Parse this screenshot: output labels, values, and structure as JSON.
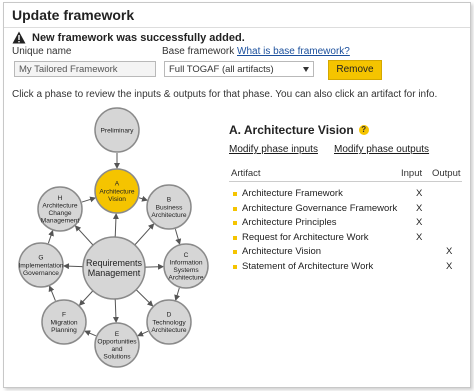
{
  "window": {
    "title": "Update framework"
  },
  "alert": {
    "message": "New framework was successfully added.",
    "icon": "warning-icon"
  },
  "form": {
    "unique_name_label": "Unique name",
    "unique_name_value": "My Tailored Framework",
    "base_label": "Base framework",
    "base_help_link": "What is base framework?",
    "base_value": "Full TOGAF (all artifacts)",
    "remove_label": "Remove"
  },
  "hint": "Click a phase to review the inputs & outputs for that phase. You can also click an artifact for info.",
  "phases": {
    "preliminary": [
      "Preliminary"
    ],
    "a": [
      "A",
      "Architecture",
      "Vision"
    ],
    "b": [
      "B",
      "Business",
      "Architecture"
    ],
    "c": [
      "C",
      "Information",
      "Systems",
      "Architecture"
    ],
    "d": [
      "D",
      "Technology",
      "Architecture"
    ],
    "e": [
      "E",
      "Opportunities",
      "and",
      "Solutions"
    ],
    "f": [
      "F",
      "Migration",
      "Planning"
    ],
    "g": [
      "G",
      "Implementation",
      "Governance"
    ],
    "h": [
      "H",
      "Architecture",
      "Change",
      "Management"
    ],
    "center": [
      "Requirements",
      "Management"
    ]
  },
  "colors": {
    "selected": "#f5c400",
    "node": "#d6d6d6",
    "accent": "#f5c400"
  },
  "detail": {
    "title": "A. Architecture Vision",
    "modify_inputs": "Modify phase inputs",
    "modify_outputs": "Modify phase outputs",
    "col_artifact": "Artifact",
    "col_input": "Input",
    "col_output": "Output",
    "rows": [
      {
        "name": "Architecture Framework",
        "input": "X",
        "output": ""
      },
      {
        "name": "Architecture Governance Framework",
        "input": "X",
        "output": ""
      },
      {
        "name": "Architecture Principles",
        "input": "X",
        "output": ""
      },
      {
        "name": "Request for Architecture Work",
        "input": "X",
        "output": ""
      },
      {
        "name": "Architecture Vision",
        "input": "",
        "output": "X"
      },
      {
        "name": "Statement of Architecture Work",
        "input": "",
        "output": "X"
      }
    ]
  }
}
